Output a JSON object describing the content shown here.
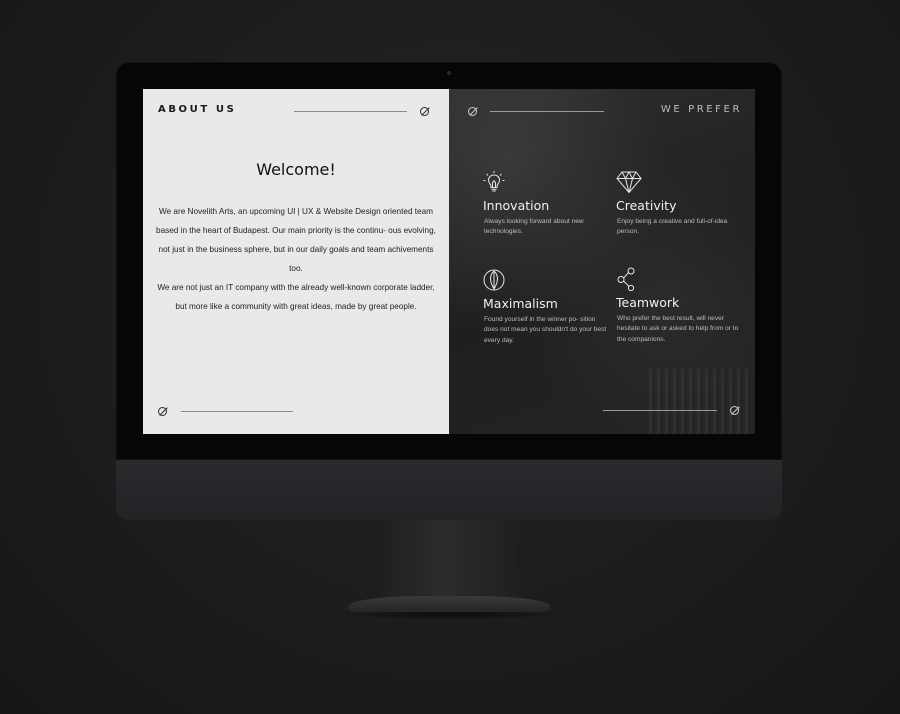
{
  "about": {
    "title": "ABOUT US",
    "heading": "Welcome!",
    "paragraph1": "We are Novelith Arts, an upcoming UI | UX & Website Design oriented team based in the heart of Budapest. Our main priority is the continu- ous evolving, not just in the business sphere, but in our daily goals and team achivements too.",
    "paragraph2": "We are not just an IT company with the already well-known corporate ladder, but more like a community with great ideas, made by great people."
  },
  "prefer": {
    "title": "WE PREFER",
    "features": [
      {
        "icon": "lightbulb-icon",
        "title": "Innovation",
        "description": "Always looking forward about new technologies."
      },
      {
        "icon": "diamond-icon",
        "title": "Creativity",
        "description": "Enjoy being a creative and full-of-idea person."
      },
      {
        "icon": "leaf-icon",
        "title": "Maximalism",
        "description": "Found yourself in the winner po- sition does not mean you shouldn't do your best every day."
      },
      {
        "icon": "share-icon",
        "title": "Teamwork",
        "description": "Who prefer the best result, will never hesitate to ask or asked to help from or to the companions."
      }
    ]
  },
  "colors": {
    "left_panel_bg": "#e9e9e9",
    "right_panel_bg": "#242426",
    "page_bg": "#1d1d1f"
  }
}
